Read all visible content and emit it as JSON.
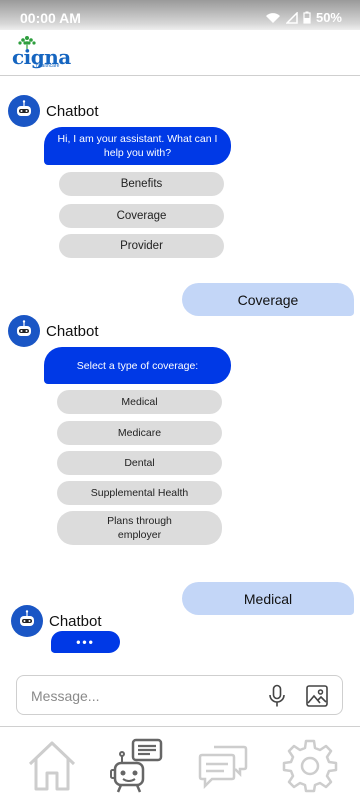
{
  "status_bar": {
    "time": "00:00 AM",
    "battery": "50%"
  },
  "header": {
    "logo_text": "cigna",
    "logo_sub": "healthcare"
  },
  "chat": {
    "bot_name": "Chatbot",
    "messages": [
      {
        "bot_text": "Hi, I am your assistant. What can I help you with?"
      },
      {
        "bot_text": "Select a type of coverage:"
      },
      {
        "bot_text": "•••"
      }
    ],
    "options_1": [
      "Benefits",
      "Coverage",
      "Provider"
    ],
    "options_2": [
      "Medical",
      "Medicare",
      "Dental",
      "Supplemental Health",
      "Plans through employer"
    ],
    "user_messages": [
      "Coverage",
      "Medical"
    ]
  },
  "composer": {
    "placeholder": "Message..."
  },
  "colors": {
    "brand_blue": "#0039e6",
    "user_bubble": "#c3d6f7",
    "option_bg": "#dcdcdc"
  },
  "icons": [
    "wifi-icon",
    "signal-icon",
    "battery-icon",
    "microphone-icon",
    "image-icon",
    "home-icon",
    "chatbot-icon",
    "messages-icon",
    "settings-icon"
  ]
}
